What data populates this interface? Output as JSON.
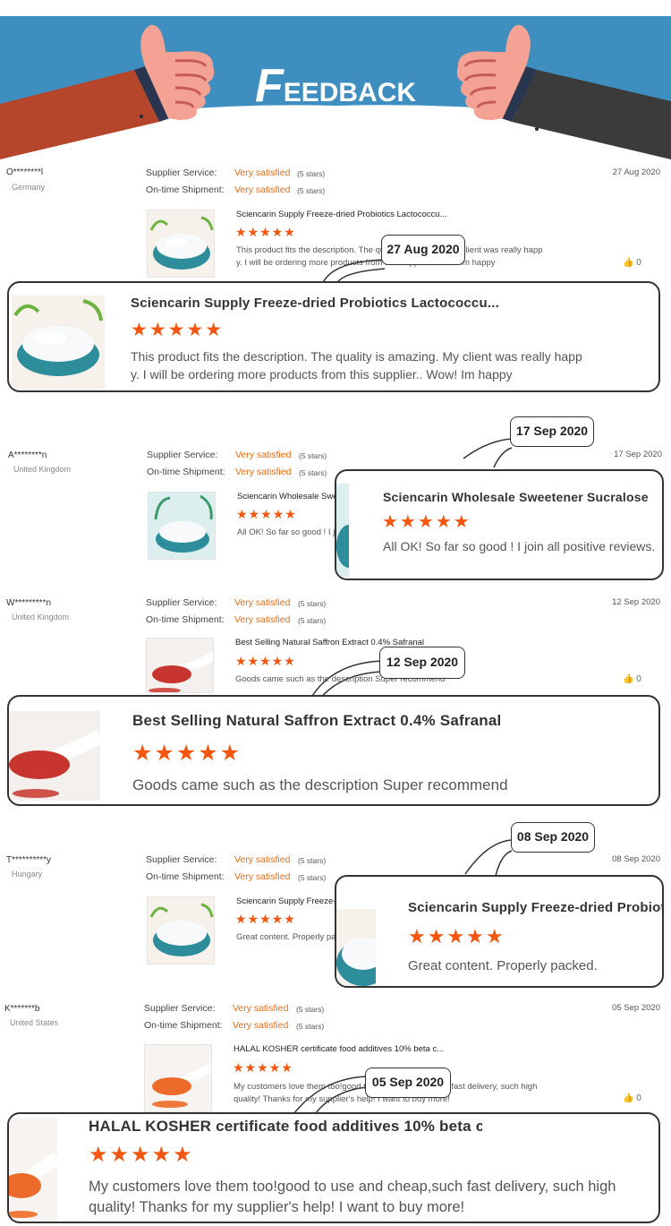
{
  "header": {
    "title_first_letter": "F",
    "title_rest": "EEDBACK",
    "colors": {
      "banner": "#3e8fbf",
      "sleeve_left": "#b5452b",
      "sleeve_right": "#3b3b3b",
      "hand": "#f3a293"
    }
  },
  "labels": {
    "supplier_service": "Supplier Service:",
    "on_time_shipment": "On-time Shipment:",
    "very_satisfied": "Very satisfied",
    "five_stars": "(5 stars)",
    "like_count": "0",
    "star_rating": "★★★★★"
  },
  "reviews": [
    {
      "buyer": "O********l",
      "country": "Germany",
      "date": "27 Aug 2020",
      "product": "Sciencarin Supply Freeze-dried Probiotics Lactococcu...",
      "text_line1": "This product fits the description. The quality is amazing. My client was really happ",
      "text_line2": "y. I will be ordering more products from this supplier.. Wow! Im happy",
      "image": "white-powder-bowl"
    },
    {
      "buyer": "A********n",
      "country": "United Kingdom",
      "date": "17 Sep 2020",
      "product": "Sciencarin Wholesale Sweetener Sucralose",
      "text_line1": "All OK! So far so good ! I join all positive reviews.",
      "text_line2": "",
      "image": "white-powder-bowl"
    },
    {
      "buyer": "W*********n",
      "country": "United Kingdom",
      "date": "12 Sep 2020",
      "product": "Best Selling Natural Saffron Extract 0.4% Safranal",
      "text_line1": "Goods came such as the description Super recommend",
      "text_line2": "",
      "image": "red-powder-spoon"
    },
    {
      "buyer": "T**********y",
      "country": "Hungary",
      "date": "08 Sep 2020",
      "product": "Sciencarin Supply Freeze-dried Probiotics Lactococcu...",
      "text_line1": "Great content. Properly packed.",
      "text_line2": "",
      "image": "white-powder-bowl"
    },
    {
      "buyer": "K*******b",
      "country": "United States",
      "date": "05 Sep 2020",
      "product": "HALAL KOSHER certificate food additives 10% beta c...",
      "text_line1": "My customers love them too!good to use and cheap,such fast delivery, such high",
      "text_line2": "quality! Thanks for my supplier's help! I want to buy more!",
      "image": "orange-powder-spoon"
    }
  ]
}
